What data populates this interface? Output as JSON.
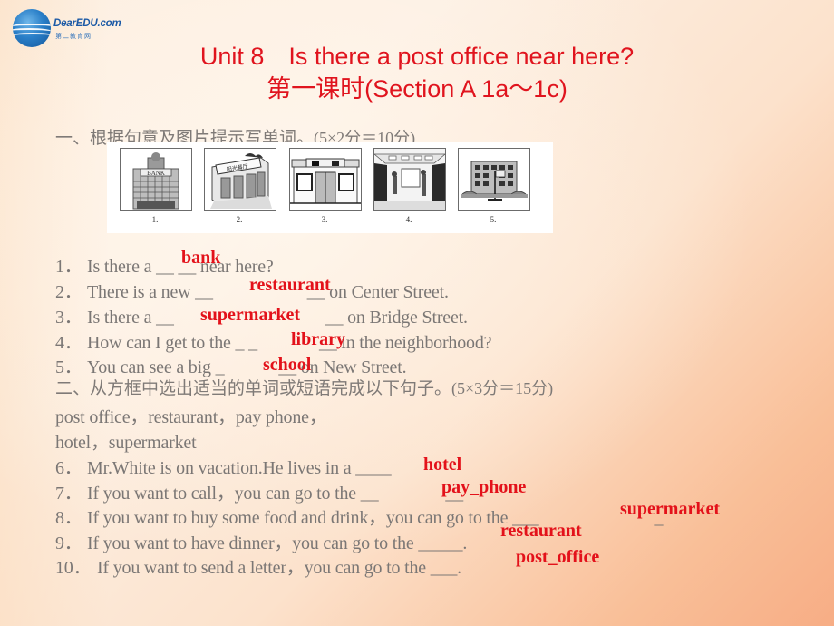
{
  "logo": {
    "brand": "DearEDU.com",
    "subtitle": "第二教育网"
  },
  "header": {
    "title_line1": "Unit 8　Is there a post office near here?",
    "title_line2": "第一课时(Section A 1a～1c)"
  },
  "colors": {
    "title_red": "#e0141e",
    "answer_red": "#e3111a",
    "body_gray": "#7b7775",
    "bg_light": "#fdeedf",
    "bg_dark": "#f7ad85"
  },
  "part1": {
    "heading": "一、根据句意及图片提示写单词。",
    "points": "(5×2分＝10分)",
    "pictures": [
      {
        "num": "1.",
        "depicts": "bank-building"
      },
      {
        "num": "2.",
        "depicts": "restaurant"
      },
      {
        "num": "3.",
        "depicts": "supermarket"
      },
      {
        "num": "4.",
        "depicts": "library"
      },
      {
        "num": "5.",
        "depicts": "school"
      }
    ],
    "questions": [
      {
        "num": "1．",
        "before": "Is there a __ __ near here?",
        "answer": "bank"
      },
      {
        "num": "2．",
        "before": "There is a new __",
        "after": "__ on Center Street.",
        "answer": "restaurant"
      },
      {
        "num": "3．",
        "before": "Is there a __",
        "after": "__ on Bridge Street.",
        "answer": "supermarket"
      },
      {
        "num": "4．",
        "before": "How can I get to the _ _",
        "after": "__ in the neighborhood?",
        "answer": "library"
      },
      {
        "num": "5．",
        "before": "You can see a big _",
        "after": "__ on New Street.",
        "answer": "school"
      }
    ]
  },
  "part2": {
    "heading": "二、从方框中选出适当的单词或短语完成以下句子。",
    "points": "(5×3分＝15分)",
    "word_box_line1": "post office，restaurant，pay phone，",
    "word_box_line2": "hotel，supermarket",
    "questions": [
      {
        "num": "6．",
        "before": "Mr.White is on vacation.He lives in a ____",
        "answer": "hotel"
      },
      {
        "num": "7．",
        "before": "If you want to call，you can go to the __",
        "after": "__",
        "answer": "pay_phone"
      },
      {
        "num": "8．",
        "before": "If you want to buy some food and drink，you can go to the ___",
        "after": "_",
        "answer": "supermarket"
      },
      {
        "num": "9．",
        "before": "If you want to have dinner，you can go to the _____.",
        "answer": "restaurant"
      },
      {
        "num": "10．",
        "before": "If you want to send a letter，you can go to the ___.",
        "answer": "post_office"
      }
    ]
  }
}
